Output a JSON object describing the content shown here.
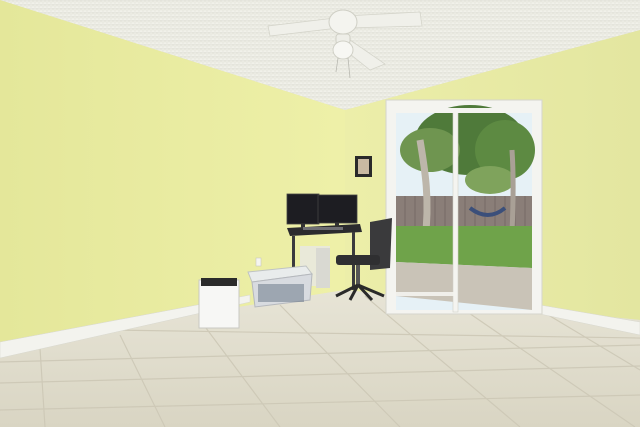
{
  "scene": {
    "kind": "photo",
    "colors": {
      "wall_left": "#ecee9a",
      "wall_right": "#e9eba4",
      "ceiling": "#efefe7",
      "floor": "#e2dfcf",
      "baseboard": "#f3f3ee",
      "grout": "#cfcab8",
      "door_frame": "#f4f4f0",
      "lawn": "#6fa34a",
      "sky": "#e6f1f6",
      "patio": "#c9c3b7",
      "fence": "#8a7e78",
      "chair": "#3a3a3c",
      "monitor": "#1d1d22",
      "desk": "#2b2b2e"
    }
  }
}
